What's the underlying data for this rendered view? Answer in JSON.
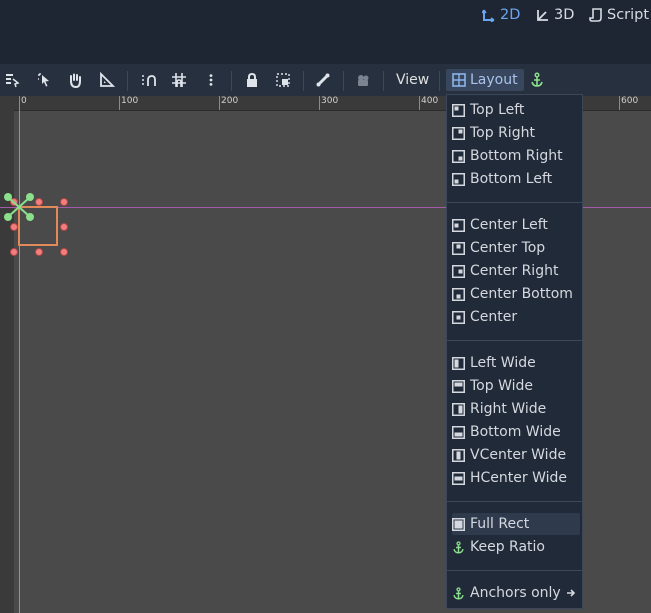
{
  "workspace": {
    "tabs": [
      {
        "label": "2D",
        "active": true
      },
      {
        "label": "3D",
        "active": false
      },
      {
        "label": "Script",
        "active": false
      }
    ]
  },
  "toolbar": {
    "view_label": "View",
    "layout_label": "Layout"
  },
  "ruler": {
    "ticks": [
      "0",
      "100",
      "200",
      "300",
      "400",
      "600"
    ]
  },
  "layout_menu": {
    "items": [
      {
        "label": "Top Left",
        "icon": "anchor-top-left-icon"
      },
      {
        "label": "Top Right",
        "icon": "anchor-top-right-icon"
      },
      {
        "label": "Bottom Right",
        "icon": "anchor-bottom-right-icon"
      },
      {
        "label": "Bottom Left",
        "icon": "anchor-bottom-left-icon"
      },
      {
        "label": "Center Left",
        "icon": "anchor-center-left-icon"
      },
      {
        "label": "Center Top",
        "icon": "anchor-center-top-icon"
      },
      {
        "label": "Center Right",
        "icon": "anchor-center-right-icon"
      },
      {
        "label": "Center Bottom",
        "icon": "anchor-center-bottom-icon"
      },
      {
        "label": "Center",
        "icon": "anchor-center-icon"
      },
      {
        "label": "Left Wide",
        "icon": "anchor-left-wide-icon"
      },
      {
        "label": "Top Wide",
        "icon": "anchor-top-wide-icon"
      },
      {
        "label": "Right Wide",
        "icon": "anchor-right-wide-icon"
      },
      {
        "label": "Bottom Wide",
        "icon": "anchor-bottom-wide-icon"
      },
      {
        "label": "VCenter Wide",
        "icon": "anchor-vcenter-wide-icon"
      },
      {
        "label": "HCenter Wide",
        "icon": "anchor-hcenter-wide-icon"
      },
      {
        "label": "Full Rect",
        "icon": "anchor-full-rect-icon"
      },
      {
        "label": "Keep Ratio",
        "icon": "anchor-icon"
      },
      {
        "label": "Anchors only",
        "icon": "anchor-icon"
      }
    ]
  },
  "colors": {
    "accent": "#6aa6ee",
    "anchor_green": "#8be08b",
    "selection_orange": "#e08a5c",
    "guide_purple": "#a45aa8"
  }
}
